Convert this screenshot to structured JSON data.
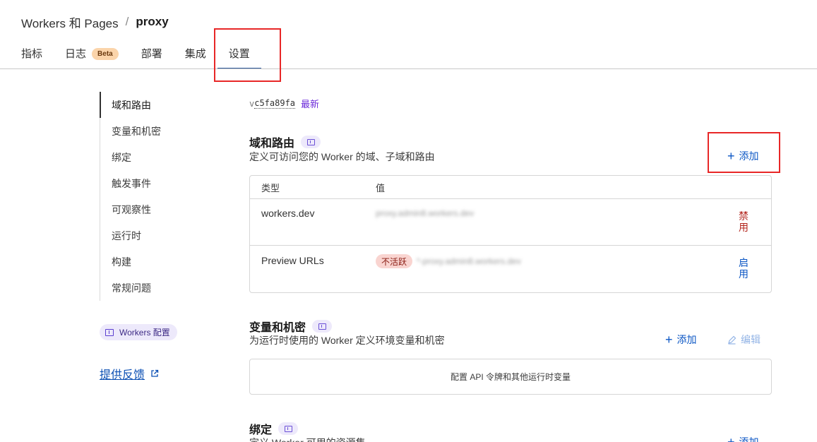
{
  "header": {
    "breadcrumb_parent": "Workers 和 Pages",
    "breadcrumb_separator": "/",
    "breadcrumb_current": "proxy",
    "tabs": [
      {
        "label": "指标"
      },
      {
        "label": "日志",
        "badge": "Beta"
      },
      {
        "label": "部署"
      },
      {
        "label": "集成"
      },
      {
        "label": "设置",
        "active": true
      }
    ]
  },
  "sidebar": {
    "items": [
      {
        "label": "域和路由",
        "active": true
      },
      {
        "label": "变量和机密"
      },
      {
        "label": "绑定"
      },
      {
        "label": "触发事件"
      },
      {
        "label": "可观察性"
      },
      {
        "label": "运行时"
      },
      {
        "label": "构建"
      },
      {
        "label": "常规问题"
      }
    ],
    "config_pill": "Workers 配置",
    "feedback": "提供反馈"
  },
  "version": {
    "prefix": "v",
    "hash": "c5fa89fa",
    "latest": "最新"
  },
  "domains": {
    "title": "域和路由",
    "description": "定义可访问您的 Worker 的域、子域和路由",
    "add": "添加",
    "headers": {
      "type": "类型",
      "value": "值"
    },
    "rows": [
      {
        "type": "workers.dev",
        "value": "proxy.admin8.workers.dev",
        "action": "禁用"
      },
      {
        "type": "Preview URLs",
        "badge": "不活跃",
        "value": "*-proxy.admin8.workers.dev",
        "action": "启用"
      }
    ]
  },
  "variables": {
    "title": "变量和机密",
    "description": "为运行时使用的 Worker 定义环境变量和机密",
    "add": "添加",
    "edit": "编辑",
    "empty": "配置 API 令牌和其他运行时变量"
  },
  "bindings": {
    "title": "绑定",
    "description": "定义 Worker 可用的资源集",
    "add": "添加"
  },
  "colors": {
    "accent_link": "#0b56c4",
    "danger": "#b3261e",
    "highlight_box": "#e82727",
    "tab_underline": "#2f5b9e",
    "latest": "#6c2bd9"
  }
}
